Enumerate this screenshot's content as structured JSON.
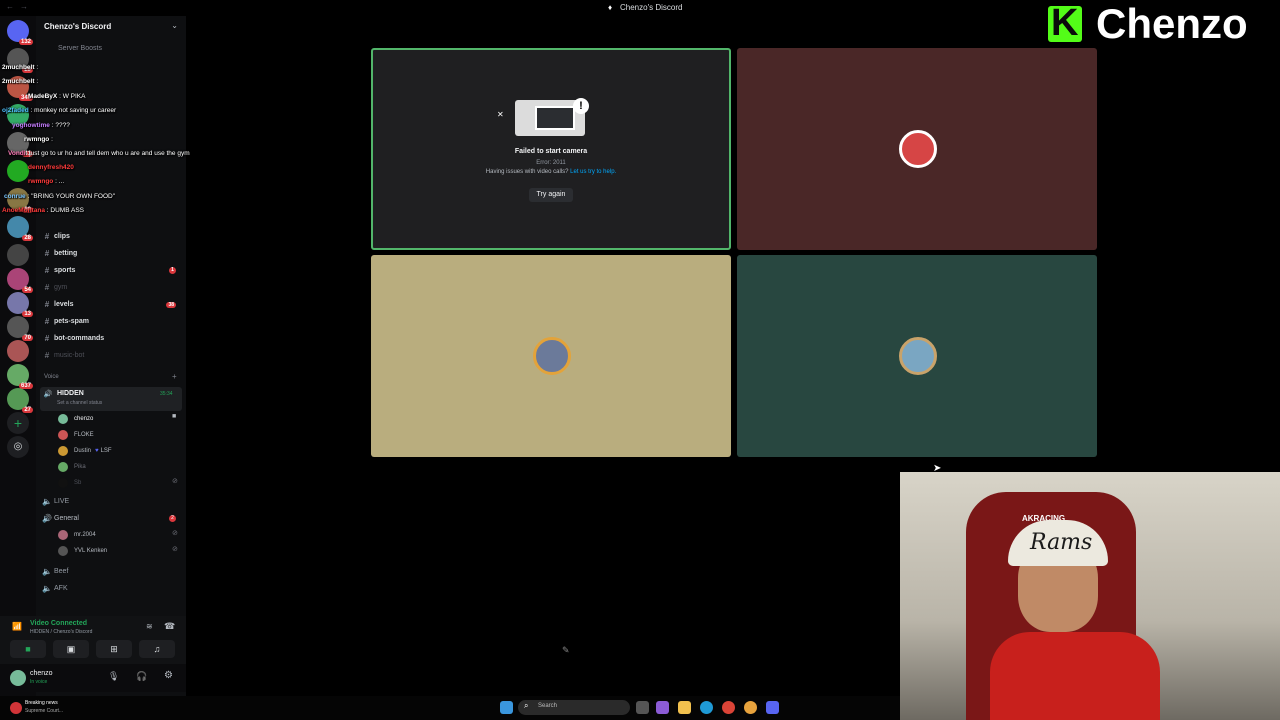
{
  "window": {
    "title": "Chenzo's Discord"
  },
  "brand": {
    "logo_letter": "K",
    "name": "Chenzo",
    "accent": "#53fc18"
  },
  "server": {
    "name": "Chenzo's Discord",
    "boosts": "Server Boosts"
  },
  "rail_badges": [
    "132",
    "29",
    "347",
    "41",
    "60",
    "28",
    "54",
    "13",
    "70",
    "637",
    "27"
  ],
  "chat": [
    {
      "name": "2muchbelt",
      "text": ":",
      "color": "#ffffff"
    },
    {
      "name": "2muchbelt",
      "text": ":",
      "color": "#ffffff"
    },
    {
      "name": "MadeByX",
      "text": ": W PIKA",
      "color": "#ffffff"
    },
    {
      "name": "oj2faded",
      "text": ": monkey not saving ur career",
      "color": "#4fc1ff"
    },
    {
      "name": "yoghowtime",
      "text": ": ????",
      "color": "#c57cff"
    },
    {
      "name": "rwmngo",
      "text": ":",
      "color": "#ffffff"
    },
    {
      "name": "Vondi",
      "text": ": just go to ur ho and tell dem who u are and use the gym",
      "color": "#ff7ab8"
    },
    {
      "name": "dennyfresh420",
      "text": "",
      "color": "#ff3b3b"
    },
    {
      "name": "rwmngo",
      "text": ": ...",
      "color": "#ff3b3b"
    },
    {
      "name": "conrue",
      "text": ": \"BRING YOUR OWN FOOD\"",
      "color": "#7cc7ff"
    },
    {
      "name": "AnoeMontana",
      "text": ": DUMB ASS",
      "color": "#ff3b3b"
    }
  ],
  "channels": [
    {
      "name": "clips",
      "bright": true,
      "count": ""
    },
    {
      "name": "betting",
      "bright": true,
      "count": ""
    },
    {
      "name": "sports",
      "bright": true,
      "count": "1"
    },
    {
      "name": "gym",
      "bright": false,
      "count": ""
    },
    {
      "name": "levels",
      "bright": true,
      "count": "38"
    },
    {
      "name": "pets-spam",
      "bright": true,
      "count": ""
    },
    {
      "name": "bot-commands",
      "bright": true,
      "count": ""
    },
    {
      "name": "music-bot",
      "bright": false,
      "count": ""
    }
  ],
  "voice": {
    "category": "Voice",
    "hidden_channel": {
      "name": "HIDDEN",
      "timer": "35:34",
      "status": "Set a channel status"
    },
    "hidden_users": [
      "chenzo",
      "FLOKE",
      "Dustin",
      "Pika",
      "Sb"
    ],
    "dustin_tag": "LSF",
    "live": "LIVE",
    "general": "General",
    "general_users": [
      "mr.2004",
      "YVL Kenken"
    ],
    "beef": "Beef",
    "afk": "AFK"
  },
  "connection": {
    "status": "Video Connected",
    "location": "HIDDEN / Chenzo's Discord"
  },
  "user": {
    "name": "chenzo",
    "status": "In voice"
  },
  "camera_error": {
    "title": "Failed to start camera",
    "error": "Error: 2011",
    "help_prefix": "Having issues with video calls?",
    "help_link": "Let us try to help.",
    "button": "Try again"
  },
  "tiles": [
    {
      "id": "self",
      "color": "#1f1f21",
      "border": "#52b56a"
    },
    {
      "id": "user2",
      "color": "#4a2727"
    },
    {
      "id": "user3",
      "color": "#b9ad7e"
    },
    {
      "id": "user4",
      "color": "#284740"
    }
  ],
  "taskbar": {
    "search": "Search",
    "news_title": "Breaking news",
    "news_sub": "Supreme Court..."
  },
  "webcam": {
    "cap_text": "Rams",
    "brand": "AKRACING"
  }
}
